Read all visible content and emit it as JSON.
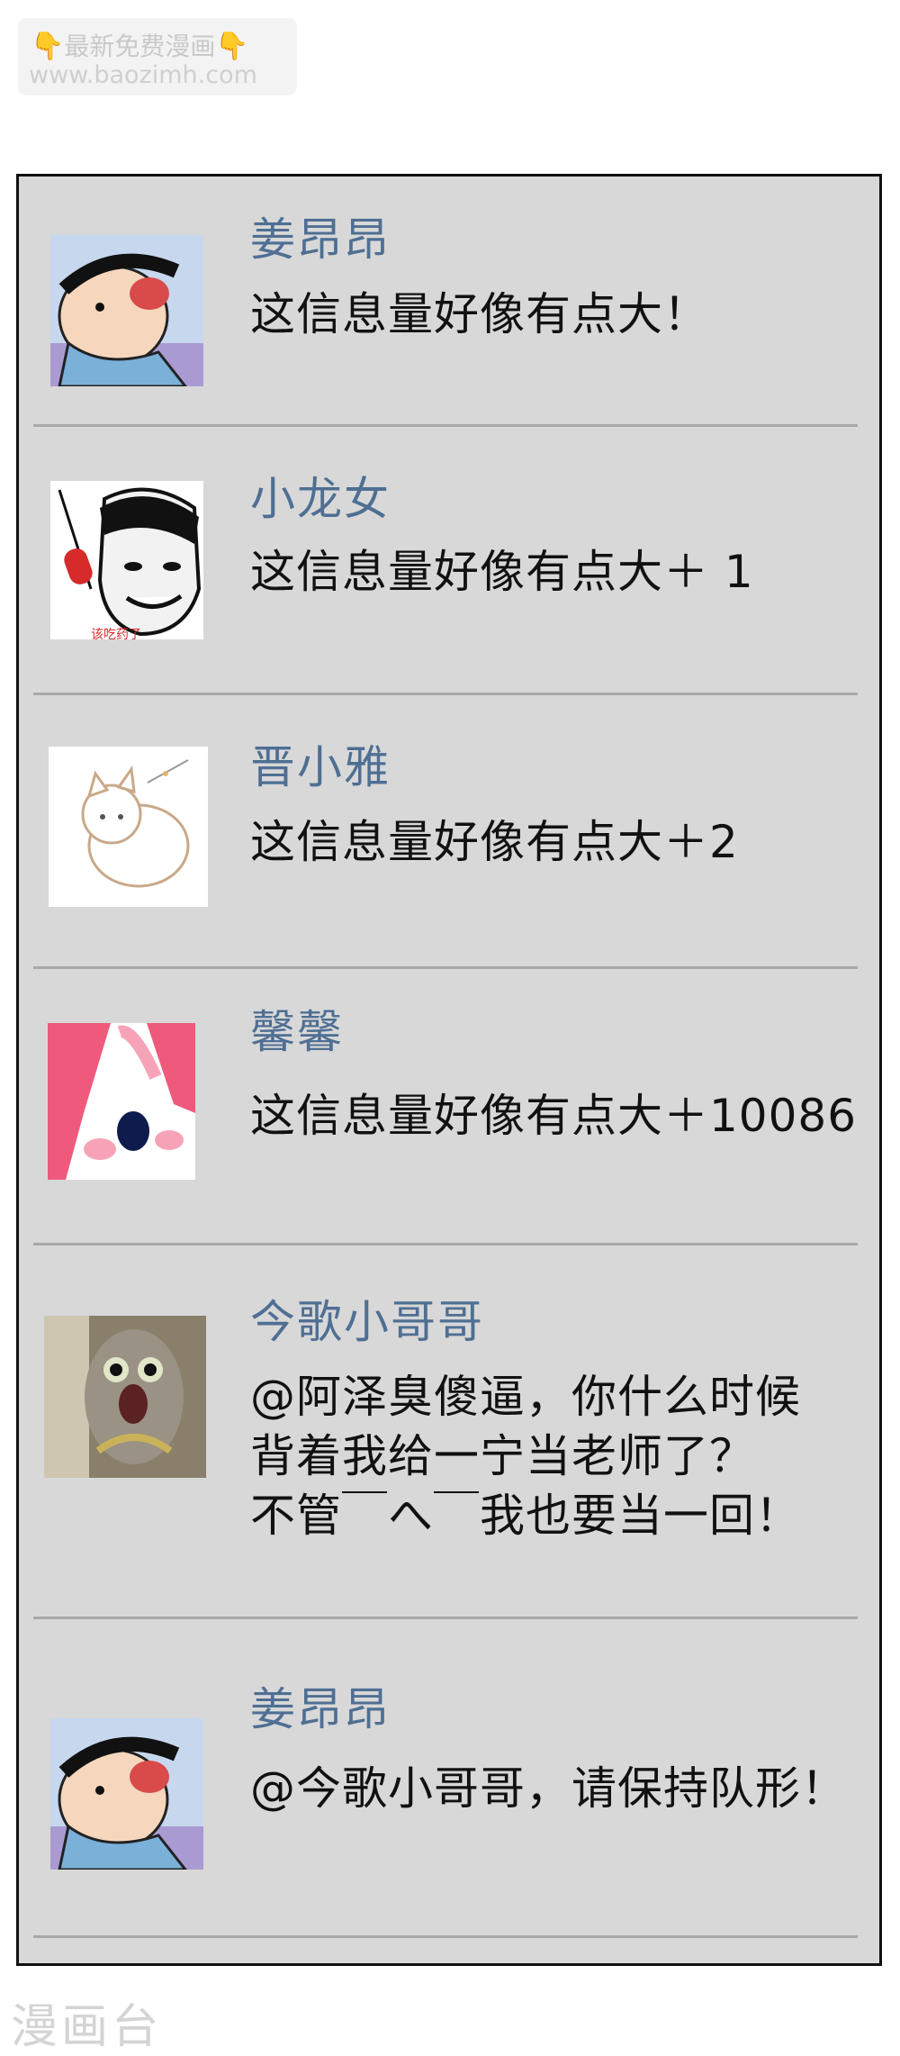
{
  "watermark_top": {
    "line1": "最新免费漫画",
    "line2": "www.baozimh.com"
  },
  "watermark_bottom": "漫画台",
  "comments": [
    {
      "name": "姜昂昂",
      "avatar": "crayon-shinchan-avatar",
      "lines": [
        "这信息量好像有点大！"
      ]
    },
    {
      "name": "小龙女",
      "avatar": "meme-face-avatar",
      "avatar_caption": "该吃药了",
      "lines": [
        "这信息量好像有点大＋ 1"
      ]
    },
    {
      "name": "晋小雅",
      "avatar": "white-cat-avatar",
      "lines": [
        "这信息量好像有点大＋2"
      ]
    },
    {
      "name": "馨馨",
      "avatar": "pink-bunny-avatar",
      "lines": [
        "这信息量好像有点大＋10086"
      ]
    },
    {
      "name": "今歌小哥哥",
      "avatar": "shocked-cat-avatar",
      "lines": [
        "@阿泽臭傻逼，你什么时候",
        "背着我给一宁当老师了？",
        "不管￣へ￣我也要当一回！"
      ]
    },
    {
      "name": "姜昂昂",
      "avatar": "crayon-shinchan-avatar",
      "lines": [
        "@今歌小哥哥，请保持队形！"
      ]
    }
  ],
  "colors": {
    "panel_bg": "#d8d8d8",
    "name": "#4f6f93",
    "message": "#111111",
    "divider": "#a9a9a9"
  }
}
